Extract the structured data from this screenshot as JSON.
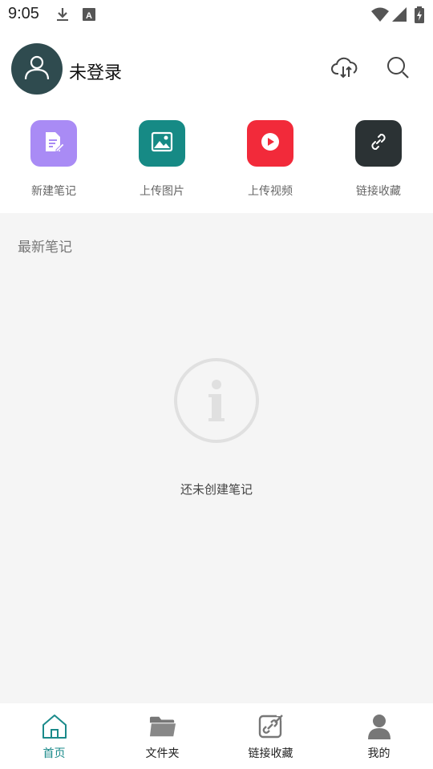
{
  "status_bar": {
    "time": "9:05",
    "icons": [
      "download-icon",
      "text-recognition-icon",
      "wifi-icon",
      "signal-icon",
      "battery-charging-icon"
    ]
  },
  "header": {
    "login_status": "未登录",
    "avatar_icon": "person-icon",
    "actions": [
      "cloud-sync-icon",
      "search-icon"
    ]
  },
  "quick_actions": [
    {
      "label": "新建笔记",
      "icon": "new-note-icon",
      "color": "#a98bf5"
    },
    {
      "label": "上传图片",
      "icon": "image-icon",
      "color": "#168a85"
    },
    {
      "label": "上传视频",
      "icon": "play-icon",
      "color": "#f22a3a"
    },
    {
      "label": "链接收藏",
      "icon": "link-icon",
      "color": "#2b3234"
    }
  ],
  "main": {
    "section_title": "最新笔记",
    "empty_icon": "info-icon",
    "empty_message": "还未创建笔记"
  },
  "bottom_nav": [
    {
      "label": "首页",
      "icon": "home-icon",
      "active": true
    },
    {
      "label": "文件夹",
      "icon": "folder-icon",
      "active": false
    },
    {
      "label": "链接收藏",
      "icon": "link-edit-icon",
      "active": false
    },
    {
      "label": "我的",
      "icon": "profile-icon",
      "active": false
    }
  ],
  "colors": {
    "accent": "#1a8a8a",
    "background": "#f5f5f5",
    "avatar_bg": "#2f4b4f"
  }
}
